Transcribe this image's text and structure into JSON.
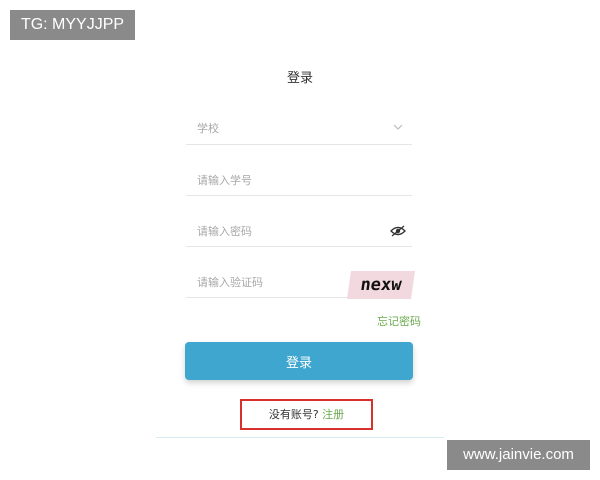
{
  "watermarks": {
    "top_left": "TG: MYYJJPP",
    "bottom_right": "www.jainvie.com"
  },
  "login_form": {
    "title": "登录",
    "school_select": {
      "placeholder": "学校",
      "icon": "chevron-down-icon"
    },
    "student_id": {
      "placeholder": "请输入学号"
    },
    "password": {
      "placeholder": "请输入密码",
      "icon": "eye-icon"
    },
    "captcha": {
      "placeholder": "请输入验证码",
      "image_text": "nexw"
    },
    "forgot_password": "忘记密码",
    "login_button": "登录",
    "register_prompt": "没有账号?",
    "register_link": "注册"
  },
  "colors": {
    "button": "#3ea6cf",
    "link": "#6aaa4f",
    "highlight_border": "#d9302c"
  }
}
